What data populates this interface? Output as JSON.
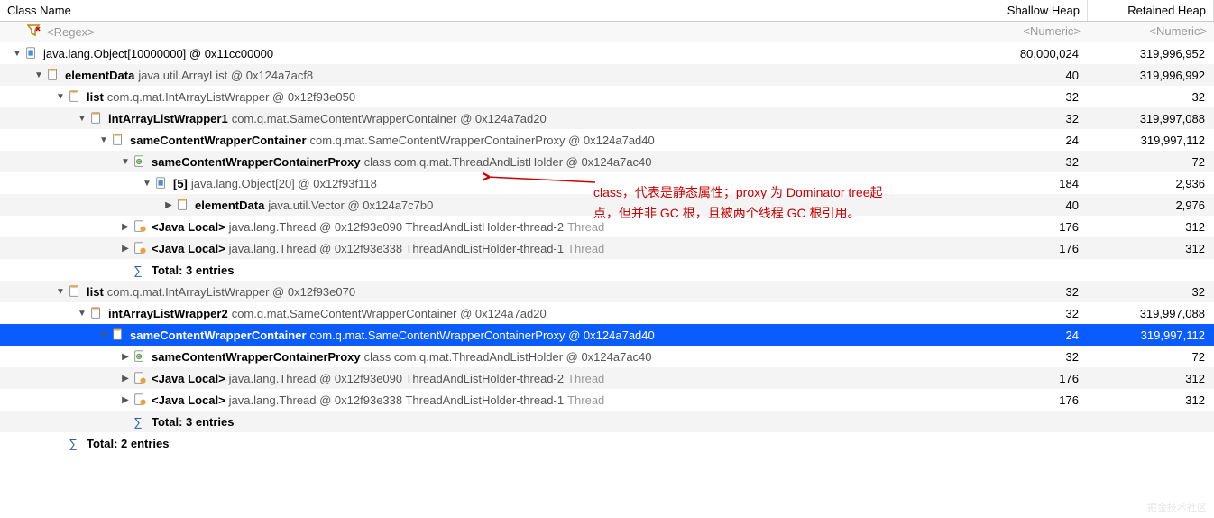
{
  "headers": {
    "name": "Class Name",
    "shallow": "Shallow Heap",
    "retained": "Retained Heap"
  },
  "filter": {
    "name": "<Regex>",
    "shallow": "<Numeric>",
    "retained": "<Numeric>"
  },
  "rows": [
    {
      "id": 0,
      "indent": 0,
      "arrow": "down",
      "icon": "array",
      "bold": "",
      "text": "java.lang.Object[10000000] @ 0x11cc00000",
      "shallow": "80,000,024",
      "retained": "319,996,952",
      "alt": false
    },
    {
      "id": 1,
      "indent": 1,
      "arrow": "down",
      "icon": "obj",
      "bold": "elementData",
      "text": "java.util.ArrayList @ 0x124a7acf8",
      "shallow": "40",
      "retained": "319,996,992",
      "alt": true
    },
    {
      "id": 2,
      "indent": 2,
      "arrow": "down",
      "icon": "obj",
      "bold": "list",
      "text": "com.q.mat.IntArrayListWrapper @ 0x12f93e050",
      "shallow": "32",
      "retained": "32",
      "alt": false
    },
    {
      "id": 3,
      "indent": 3,
      "arrow": "down",
      "icon": "obj",
      "bold": "intArrayListWrapper1",
      "text": "com.q.mat.SameContentWrapperContainer @ 0x124a7ad20",
      "shallow": "32",
      "retained": "319,997,088",
      "alt": true
    },
    {
      "id": 4,
      "indent": 4,
      "arrow": "down",
      "icon": "obj",
      "bold": "sameContentWrapperContainer",
      "text": "com.q.mat.SameContentWrapperContainerProxy @ 0x124a7ad40",
      "shallow": "24",
      "retained": "319,997,112",
      "alt": false
    },
    {
      "id": 5,
      "indent": 5,
      "arrow": "down",
      "icon": "class",
      "bold": "sameContentWrapperContainerProxy",
      "text": "class com.q.mat.ThreadAndListHolder @ 0x124a7ac40",
      "shallow": "32",
      "retained": "72",
      "alt": true
    },
    {
      "id": 6,
      "indent": 6,
      "arrow": "down",
      "icon": "array",
      "bold": "[5]",
      "text": "java.lang.Object[20] @ 0x12f93f118",
      "shallow": "184",
      "retained": "2,936",
      "alt": false
    },
    {
      "id": 7,
      "indent": 7,
      "arrow": "right",
      "icon": "obj",
      "bold": "elementData",
      "text": "java.util.Vector @ 0x124a7c7b0",
      "shallow": "40",
      "retained": "2,976",
      "alt": true
    },
    {
      "id": 8,
      "indent": 5,
      "arrow": "right",
      "icon": "thread",
      "bold": "<Java Local>",
      "text": "java.lang.Thread @ 0x12f93e090  ThreadAndListHolder-thread-2",
      "suffix2": "Thread",
      "shallow": "176",
      "retained": "312",
      "alt": false
    },
    {
      "id": 9,
      "indent": 5,
      "arrow": "right",
      "icon": "thread",
      "bold": "<Java Local>",
      "text": "java.lang.Thread @ 0x12f93e338  ThreadAndListHolder-thread-1",
      "suffix2": "Thread",
      "shallow": "176",
      "retained": "312",
      "alt": true
    },
    {
      "id": 10,
      "indent": 5,
      "arrow": "none",
      "icon": "sigma",
      "bold": "Total: 3 entries",
      "text": "",
      "shallow": "",
      "retained": "",
      "alt": false
    },
    {
      "id": 11,
      "indent": 2,
      "arrow": "down",
      "icon": "obj",
      "bold": "list",
      "text": "com.q.mat.IntArrayListWrapper @ 0x12f93e070",
      "shallow": "32",
      "retained": "32",
      "alt": true
    },
    {
      "id": 12,
      "indent": 3,
      "arrow": "down",
      "icon": "obj",
      "bold": "intArrayListWrapper2",
      "text": "com.q.mat.SameContentWrapperContainer @ 0x124a7ad20",
      "shallow": "32",
      "retained": "319,997,088",
      "alt": false
    },
    {
      "id": 13,
      "indent": 4,
      "arrow": "down",
      "icon": "obj",
      "bold": "sameContentWrapperContainer",
      "text": "com.q.mat.SameContentWrapperContainerProxy @ 0x124a7ad40",
      "shallow": "24",
      "retained": "319,997,112",
      "alt": true,
      "selected": true
    },
    {
      "id": 14,
      "indent": 5,
      "arrow": "right",
      "icon": "class",
      "bold": "sameContentWrapperContainerProxy",
      "text": "class com.q.mat.ThreadAndListHolder @ 0x124a7ac40",
      "shallow": "32",
      "retained": "72",
      "alt": false
    },
    {
      "id": 15,
      "indent": 5,
      "arrow": "right",
      "icon": "thread",
      "bold": "<Java Local>",
      "text": "java.lang.Thread @ 0x12f93e090  ThreadAndListHolder-thread-2",
      "suffix2": "Thread",
      "shallow": "176",
      "retained": "312",
      "alt": true
    },
    {
      "id": 16,
      "indent": 5,
      "arrow": "right",
      "icon": "thread",
      "bold": "<Java Local>",
      "text": "java.lang.Thread @ 0x12f93e338  ThreadAndListHolder-thread-1",
      "suffix2": "Thread",
      "shallow": "176",
      "retained": "312",
      "alt": false
    },
    {
      "id": 17,
      "indent": 5,
      "arrow": "none",
      "icon": "sigma",
      "bold": "Total: 3 entries",
      "text": "",
      "shallow": "",
      "retained": "",
      "alt": true
    },
    {
      "id": 18,
      "indent": 2,
      "arrow": "none",
      "icon": "sigma",
      "bold": "Total: 2 entries",
      "text": "",
      "shallow": "",
      "retained": "",
      "alt": false
    }
  ],
  "annotation": {
    "line1": "class，代表是静态属性；proxy 为 Dominator tree起",
    "line2": "点，但并非 GC 根，且被两个线程 GC 根引用。"
  },
  "watermark": "掘金技术社区"
}
